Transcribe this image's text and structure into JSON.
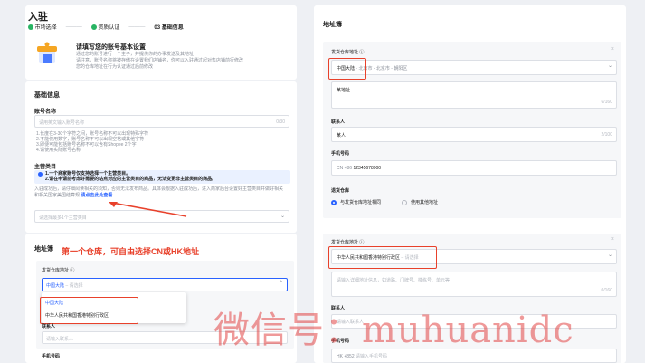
{
  "header": {
    "title": "入驻",
    "steps": [
      "市场选择",
      "资质认证",
      "03 基础信息"
    ]
  },
  "intro": {
    "title": "请填写您的账号基本设置",
    "lines": [
      "通过您的账号进行一个主子，并提供你的办事发送及其地址",
      "请注意，账号名称将被存储在设置我们店铺名，你可以入驻通过起对售店铺前行修改",
      "您的仓库地址在行为认证通过后前修改"
    ]
  },
  "basic": {
    "section_title": "基础信息",
    "account_label": "账号名称",
    "account_placeholder": "请用英文输入账号名称",
    "account_counter": "0/30",
    "hints": [
      "1.长度在3-30个字符之间，账号名称不可以出现特殊字符",
      "2.不能仅用数字，账号名称不可以出现空格或其他字符",
      "3.即便可能包括账号名称不可以含有Shopee 2个字",
      "4.请使用实际账号名称"
    ],
    "site_label": "主营类目",
    "notice_lines": [
      "1.一个商家账号仅支持选择一个主营类目。",
      "2.请在申请前考虑好需要的站点对应的主营类目的商品，无法变更非主营类目的商品。"
    ],
    "desc_lines": [
      "入驻成功后，请仔细阅读相关的须知，否则无法发布商品。具体会根据入驻成功后，进入商家后台设置好主营类目并做好相关",
      "和相关国家美国结算规"
    ],
    "link_text": "请点击此处查看",
    "select_placeholder": "请选择最多1个主营类目"
  },
  "left_addr": {
    "title": "地址簿",
    "annotation": "第一个仓库，可自由选择CN或HK地址",
    "warehouse_label": "发货仓库地址 ⓘ",
    "region_selected": "中国大陆",
    "region_placeholder": "请选择",
    "options": [
      "中国大陆",
      "中华人民共和国香港特别行政区"
    ],
    "contact_label": "联系人",
    "contact_placeholder": "请输入联系人",
    "phone_label": "手机号码"
  },
  "right_addr": {
    "title": "地址簿",
    "card1": {
      "label": "发货仓库地址 ⓘ",
      "region_prefix": "中国大陆",
      "region_rest": " - 北京市 - 北京市 - 朝阳区",
      "address": "某地址",
      "address_counter": "6/160",
      "contact_label": "联系人",
      "contact_value": "某人",
      "contact_counter": "2/100",
      "phone_label": "手机号码",
      "phone_code": "CN +86",
      "phone_value": "12345678900",
      "return_label": "退货仓库",
      "radio1": "与发货仓库地址相同",
      "radio2": "使用其他地址"
    },
    "card2": {
      "label": "发货仓库地址 ⓘ",
      "region_selected": "中华人民共和国香港特别行政区",
      "region_placeholder": "请选择",
      "address_placeholder": "请输入详细地址信息，如道路、门牌号、楼栋号、单元等",
      "address_counter": "0/160",
      "contact_label": "联系人",
      "contact_placeholder": "请输入联系人",
      "phone_label": "手机号码",
      "phone_code": "HK +852",
      "phone_placeholder": "请输入手机号码"
    }
  },
  "watermark": "微信号：muhuanidc",
  "colors": {
    "accent": "#2962ff",
    "annotation_red": "#e8412b",
    "step_green": "#28b463",
    "background": "#eef0f4"
  }
}
